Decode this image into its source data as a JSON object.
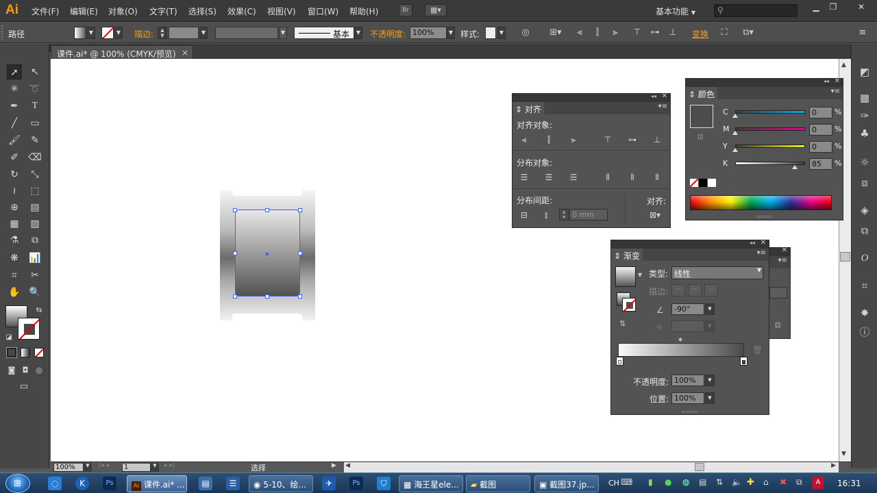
{
  "app": {
    "logo": "Ai",
    "colors": {
      "accent": "#ff9a00",
      "selection": "#3a63ff"
    }
  },
  "menu": [
    "文件(F)",
    "编辑(E)",
    "对象(O)",
    "文字(T)",
    "选择(S)",
    "效果(C)",
    "视图(V)",
    "窗口(W)",
    "帮助(H)"
  ],
  "menu_right": {
    "bridge": "Br",
    "workspace": "基本功能"
  },
  "control": {
    "selection_type": "路径",
    "stroke_label": "描边:",
    "stroke_style": "基本",
    "opacity_label": "不透明度:",
    "opacity_value": "100%",
    "style_label": "样式:",
    "transform_label": "变换"
  },
  "document_tab": {
    "title": "课件.ai* @ 100% (CMYK/预览)",
    "close": "×"
  },
  "align_panel": {
    "title": "对齐",
    "align_objects": "对齐对象:",
    "distribute_objects": "分布对象:",
    "distribute_spacing": "分布间距:",
    "align_to": "对齐:",
    "spacing_value": "0 mm"
  },
  "color_panel": {
    "title": "颜色",
    "channels": [
      {
        "name": "C",
        "value": "0",
        "unit": "%",
        "level": 0.0,
        "color": "#00aeef"
      },
      {
        "name": "M",
        "value": "0",
        "unit": "%",
        "level": 0.0,
        "color": "#ec008c"
      },
      {
        "name": "Y",
        "value": "0",
        "unit": "%",
        "level": 0.0,
        "color": "#fff200"
      },
      {
        "name": "K",
        "value": "85",
        "unit": "%",
        "level": 0.85,
        "color": "#000000"
      }
    ]
  },
  "gradient_panel": {
    "title": "渐变",
    "type_label": "类型:",
    "type_value": "线性",
    "stroke_label": "描边:",
    "angle_value": "-90°",
    "opacity_label": "不透明度:",
    "opacity_value": "100%",
    "location_label": "位置:",
    "location_value": "100%"
  },
  "status": {
    "zoom": "100%",
    "page": "1",
    "tool": "选择"
  },
  "taskbar": {
    "items": [
      "课件.ai* ...",
      "5-10、绘...",
      "海王星ele...",
      "截图",
      "截图37.jp..."
    ],
    "lang": "CH",
    "clock": "16:31"
  }
}
